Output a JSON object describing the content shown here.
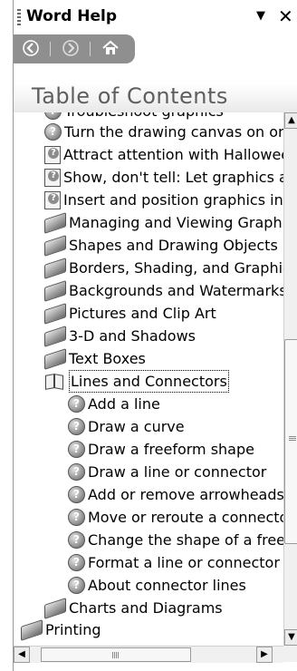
{
  "window": {
    "title": "Word Help",
    "dropdown_glyph": "▼",
    "close_glyph": "✕"
  },
  "nav": {
    "back_icon": "back-arrow-icon",
    "forward_icon": "forward-arrow-icon",
    "home_icon": "home-icon"
  },
  "toc": {
    "title": "Table of Contents",
    "items": [
      {
        "label": "Troubleshoot graphics",
        "icon": "help-topic-icon"
      },
      {
        "label": "Turn the drawing canvas on or",
        "icon": "help-topic-icon"
      },
      {
        "label": "Attract attention with Hallowee",
        "icon": "help-document-icon"
      },
      {
        "label": "Show, don't tell: Let graphics a",
        "icon": "help-document-icon"
      },
      {
        "label": "Insert and position graphics in '",
        "icon": "help-document-icon"
      },
      {
        "label": "Managing and Viewing Graphics",
        "icon": "closed-book-icon"
      },
      {
        "label": "Shapes and Drawing Objects",
        "icon": "closed-book-icon"
      },
      {
        "label": "Borders, Shading, and Graphic",
        "icon": "closed-book-icon"
      },
      {
        "label": "Backgrounds and Watermarks",
        "icon": "closed-book-icon"
      },
      {
        "label": "Pictures and Clip Art",
        "icon": "closed-book-icon"
      },
      {
        "label": "3-D and Shadows",
        "icon": "closed-book-icon"
      },
      {
        "label": "Text Boxes",
        "icon": "closed-book-icon"
      },
      {
        "label": "Lines and Connectors",
        "icon": "open-book-icon"
      },
      {
        "label": "Add a line",
        "icon": "help-topic-icon"
      },
      {
        "label": "Draw a curve",
        "icon": "help-topic-icon"
      },
      {
        "label": "Draw a freeform shape",
        "icon": "help-topic-icon"
      },
      {
        "label": "Draw a line or connector",
        "icon": "help-topic-icon"
      },
      {
        "label": "Add or remove arrowheads",
        "icon": "help-topic-icon"
      },
      {
        "label": "Move or reroute a connecto",
        "icon": "help-topic-icon"
      },
      {
        "label": "Change the shape of a free",
        "icon": "help-topic-icon"
      },
      {
        "label": "Format a line or connector",
        "icon": "help-topic-icon"
      },
      {
        "label": "About connector lines",
        "icon": "help-topic-icon"
      },
      {
        "label": "Charts and Diagrams",
        "icon": "closed-book-icon"
      },
      {
        "label": "Printing",
        "icon": "closed-book-icon"
      }
    ]
  },
  "scrollbars": {
    "up_glyph": "▲",
    "down_glyph": "▼",
    "left_glyph": "◀",
    "right_glyph": "▶"
  }
}
